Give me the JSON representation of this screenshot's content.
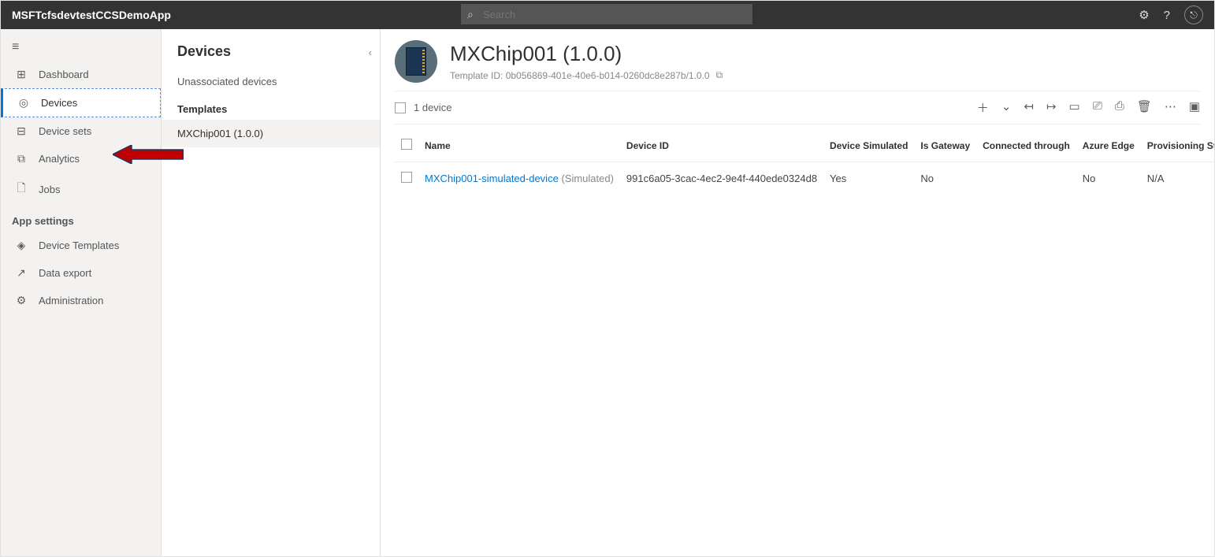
{
  "header": {
    "app_title": "MSFTcfsdevtestCCSDemoApp",
    "search_placeholder": "Search"
  },
  "nav": {
    "items": [
      {
        "icon": "⊞",
        "label": "Dashboard",
        "active": false
      },
      {
        "icon": "◎",
        "label": "Devices",
        "active": true
      },
      {
        "icon": "⊟",
        "label": "Device sets",
        "active": false
      },
      {
        "icon": "⧉",
        "label": "Analytics",
        "active": false
      },
      {
        "icon": "🗋",
        "label": "Jobs",
        "active": false
      }
    ],
    "settings_header": "App settings",
    "settings_items": [
      {
        "icon": "◈",
        "label": "Device Templates"
      },
      {
        "icon": "↗",
        "label": "Data export"
      },
      {
        "icon": "⚙",
        "label": "Administration"
      }
    ]
  },
  "subnav": {
    "title": "Devices",
    "unassociated": "Unassociated devices",
    "templates_header": "Templates",
    "template_item": "MXChip001 (1.0.0)"
  },
  "detail": {
    "title": "MXChip001 (1.0.0)",
    "template_id_label": "Template ID: 0b056869-401e-40e6-b014-0260dc8e287b/1.0.0",
    "device_count": "1 device"
  },
  "table": {
    "columns": {
      "name": "Name",
      "device_id": "Device ID",
      "simulated": "Device Simulated",
      "gateway": "Is Gateway",
      "connected": "Connected through",
      "edge": "Azure Edge",
      "prov": "Provisioning Stat"
    },
    "row": {
      "name": "MXChip001-simulated-device",
      "name_suffix": "(Simulated)",
      "device_id": "991c6a05-3cac-4ec2-9e4f-440ede0324d8",
      "simulated": "Yes",
      "gateway": "No",
      "connected": "",
      "edge": "No",
      "prov": "N/A"
    }
  }
}
